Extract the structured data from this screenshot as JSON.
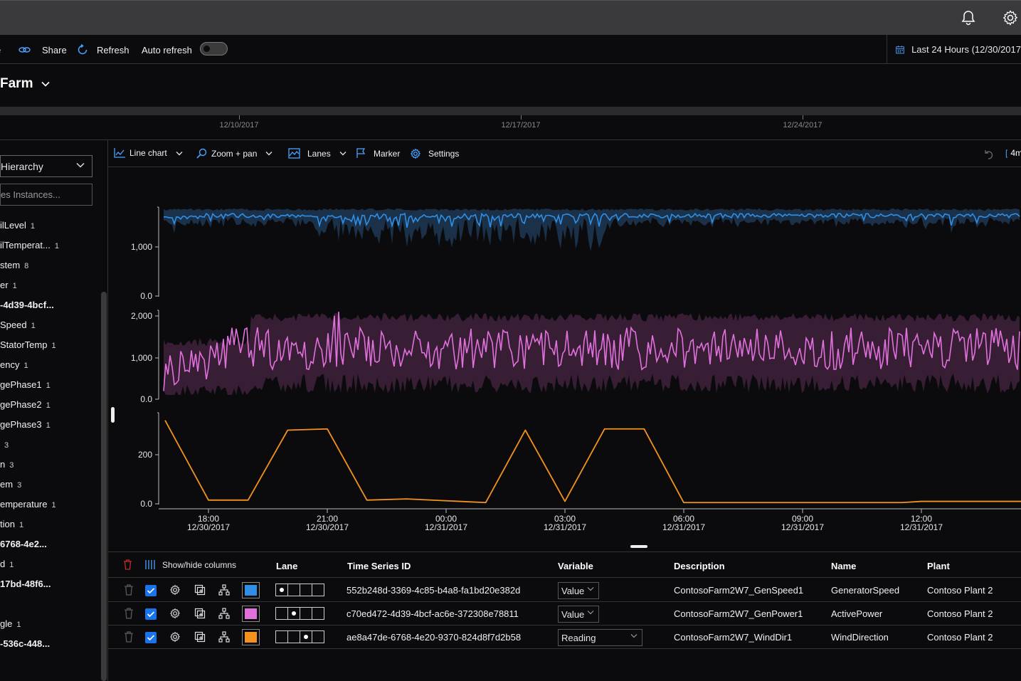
{
  "command_bar": {
    "share_label": "Share",
    "refresh_label": "Refresh",
    "auto_refresh_label": "Auto refresh",
    "date_range": "Last 24 Hours (12/30/2017"
  },
  "environment": {
    "title": "Farm"
  },
  "timeline": {
    "labels": [
      "12/10/2017",
      "12/17/2017",
      "12/24/2017"
    ]
  },
  "left_pane": {
    "hierarchy_select": "Hierarchy",
    "search_placeholder": "es Instances...",
    "items": [
      {
        "label": "ilLevel",
        "count": "1",
        "bold": false
      },
      {
        "label": "ilTemperat...",
        "count": "1",
        "bold": false
      },
      {
        "label": "stem",
        "count": "8",
        "bold": false
      },
      {
        "label": "er",
        "count": "1",
        "bold": false
      },
      {
        "label": "-4d39-4bcf...",
        "count": "",
        "bold": true
      },
      {
        "label": "Speed",
        "count": "1",
        "bold": false
      },
      {
        "label": "StatorTemp",
        "count": "1",
        "bold": false
      },
      {
        "label": "ency",
        "count": "1",
        "bold": false
      },
      {
        "label": "gePhase1",
        "count": "1",
        "bold": false
      },
      {
        "label": "gePhase2",
        "count": "1",
        "bold": false
      },
      {
        "label": "gePhase3",
        "count": "1",
        "bold": false
      },
      {
        "label": "",
        "count": "3",
        "bold": false
      },
      {
        "label": "n",
        "count": "3",
        "bold": false
      },
      {
        "label": "em",
        "count": "3",
        "bold": false
      },
      {
        "label": "emperature",
        "count": "1",
        "bold": false
      },
      {
        "label": "tion",
        "count": "1",
        "bold": false
      },
      {
        "label": "6768-4e2...",
        "count": "",
        "bold": true
      },
      {
        "label": "d",
        "count": "1",
        "bold": false
      },
      {
        "label": "17bd-48f6...",
        "count": "",
        "bold": true
      },
      {
        "label": "",
        "count": "",
        "bold": false
      },
      {
        "label": "gle",
        "count": "1",
        "bold": false
      },
      {
        "label": "-536c-448...",
        "count": "",
        "bold": true
      }
    ]
  },
  "chart_toolbar": {
    "chart_type": "Line chart",
    "zoom_label": "Zoom + pan",
    "lanes_label": "Lanes",
    "marker_label": "Marker",
    "settings_label": "Settings",
    "interval_label": "4m"
  },
  "chart_data": {
    "type": "line",
    "lanes": [
      {
        "name": "GeneratorSpeed",
        "color": "#2f8fe6",
        "yticks": [
          "1,000",
          "0.0"
        ],
        "yrange": [
          0,
          1800
        ]
      },
      {
        "name": "ActivePower",
        "color": "#e070dc",
        "yticks": [
          "2,000",
          "1,000",
          "0.0"
        ],
        "yrange": [
          0,
          2100
        ]
      },
      {
        "name": "WindDirection",
        "color": "#f5921e",
        "yticks": [
          "200",
          "0.0"
        ],
        "yrange": [
          0,
          360
        ]
      }
    ],
    "x_ticks": [
      {
        "time": "18:00",
        "date": "12/30/2017"
      },
      {
        "time": "21:00",
        "date": "12/30/2017"
      },
      {
        "time": "00:00",
        "date": "12/31/2017"
      },
      {
        "time": "03:00",
        "date": "12/31/2017"
      },
      {
        "time": "06:00",
        "date": "12/31/2017"
      },
      {
        "time": "09:00",
        "date": "12/31/2017"
      },
      {
        "time": "12:00",
        "date": "12/31/2017"
      }
    ],
    "wind_direction_points": [
      [
        "16:30",
        340
      ],
      [
        "18:00",
        15
      ],
      [
        "19:00",
        15
      ],
      [
        "20:00",
        300
      ],
      [
        "21:00",
        305
      ],
      [
        "22:00",
        15
      ],
      [
        "23:00",
        20
      ],
      [
        "01:00",
        5
      ],
      [
        "02:00",
        300
      ],
      [
        "03:00",
        10
      ],
      [
        "04:00",
        305
      ],
      [
        "05:00",
        305
      ],
      [
        "06:00",
        5
      ],
      [
        "11:30",
        5
      ],
      [
        "12:00",
        10
      ],
      [
        "14:30",
        10
      ]
    ]
  },
  "grid": {
    "show_hide_label": "Show/hide columns",
    "headers": {
      "lane": "Lane",
      "tsid": "Time Series ID",
      "variable": "Variable",
      "description": "Description",
      "name": "Name",
      "plant": "Plant"
    },
    "rows": [
      {
        "color": "#2f8fe6",
        "lane": 0,
        "tsid": "552b248d-3369-4c85-b4a8-fa1bd20e382d",
        "variable": "Value",
        "description": "ContosoFarm2W7_GenSpeed1",
        "name": "GeneratorSpeed",
        "plant": "Contoso Plant 2"
      },
      {
        "color": "#e070dc",
        "lane": 1,
        "tsid": "c70ed472-4d39-4bcf-ac6e-372308e78811",
        "variable": "Value",
        "description": "ContosoFarm2W7_GenPower1",
        "name": "ActivePower",
        "plant": "Contoso Plant 2"
      },
      {
        "color": "#f5921e",
        "lane": 2,
        "tsid": "ae8a47de-6768-4e20-9370-824d8f7d2b58",
        "variable": "Reading",
        "description": "ContosoFarm2W7_WindDir1",
        "name": "WindDirection",
        "plant": "Contoso Plant 2"
      }
    ]
  }
}
